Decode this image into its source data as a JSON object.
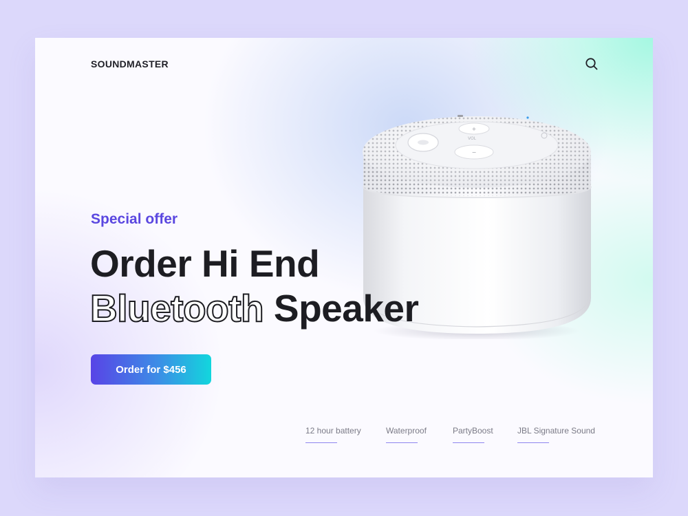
{
  "header": {
    "brand": "SOUNDMASTER",
    "search_icon": "search-icon"
  },
  "hero": {
    "eyebrow": "Special offer",
    "headline_line1": "Order Hi End",
    "headline_outline_word": "Bluetooth",
    "headline_rest": "Speaker",
    "cta_label": "Order for $456"
  },
  "features": [
    {
      "label": "12 hour battery"
    },
    {
      "label": "Waterproof"
    },
    {
      "label": "PartyBoost"
    },
    {
      "label": "JBL Signature Sound"
    }
  ],
  "product_image": {
    "speaker_labels": {
      "vol": "VOL"
    }
  },
  "colors": {
    "page_background": "#dcd8fb",
    "accent_purple": "#5a47e0",
    "cta_gradient_start": "#5844e6",
    "cta_gradient_end": "#12d6dd",
    "headline": "#1d1d22",
    "feature_underline": "#8d84ee"
  }
}
